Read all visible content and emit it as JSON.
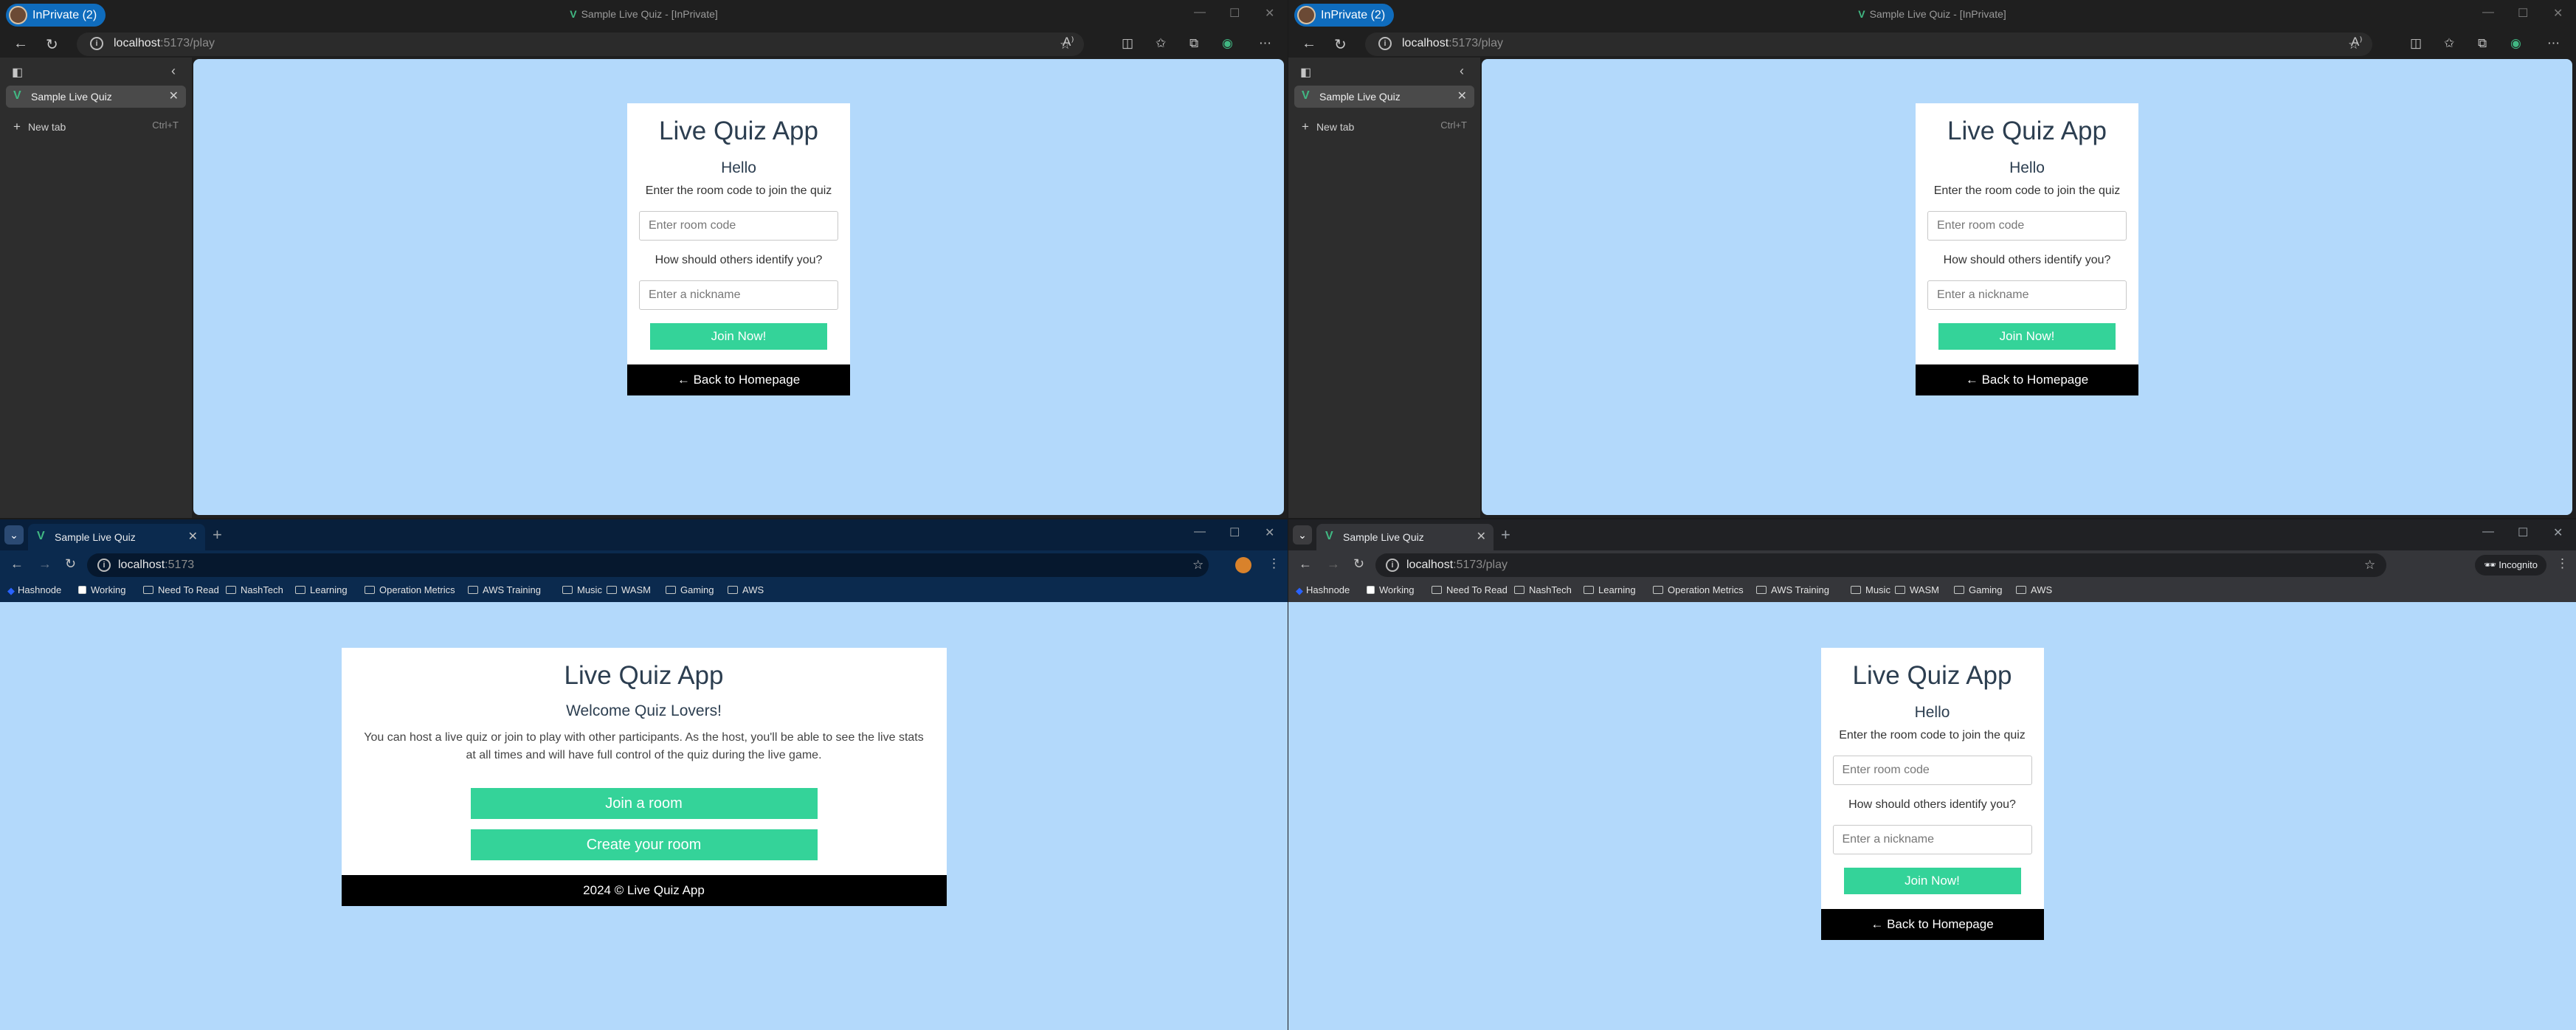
{
  "quiz": {
    "app_title": "Live Quiz App",
    "hello": "Hello",
    "instruction": "Enter the room code to join the quiz",
    "room_placeholder": "Enter room code",
    "identify_question": "How should others identify you?",
    "nickname_placeholder": "Enter a nickname",
    "join_button": "Join Now!",
    "back_button": "← Back to Homepage"
  },
  "home": {
    "app_title": "Live Quiz App",
    "welcome": "Welcome Quiz Lovers!",
    "description": "You can host a live quiz or join to play with other participants. As the host, you'll be able to see the live stats at all times and will have full control of the quiz during the live game.",
    "join_room": "Join a room",
    "create_room": "Create your room",
    "footer": "2024 © Live Quiz App"
  },
  "edge": {
    "profile_label": "InPrivate (2)",
    "window_title": "Sample Live Quiz - [InPrivate]",
    "url_host": "localhost",
    "url_path": ":5173/play",
    "tab_label": "Sample Live Quiz",
    "new_tab": "New tab",
    "new_tab_shortcut": "Ctrl+T"
  },
  "chrome_blue": {
    "tab_label": "Sample Live Quiz",
    "url_host": "localhost",
    "url_path": ":5173"
  },
  "chrome_incognito": {
    "tab_label": "Sample Live Quiz",
    "url_host": "localhost",
    "url_path": ":5173/play",
    "incognito_label": "Incognito"
  },
  "bookmarks": [
    "Hashnode",
    "Working",
    "Need To Read",
    "NashTech",
    "Learning",
    "Operation Metrics",
    "AWS Training",
    "Music",
    "WASM",
    "Gaming",
    "AWS"
  ],
  "colors": {
    "accent": "#34d399",
    "page_bg": "#b3d9fb",
    "edge_profile": "#0f6cbd"
  }
}
